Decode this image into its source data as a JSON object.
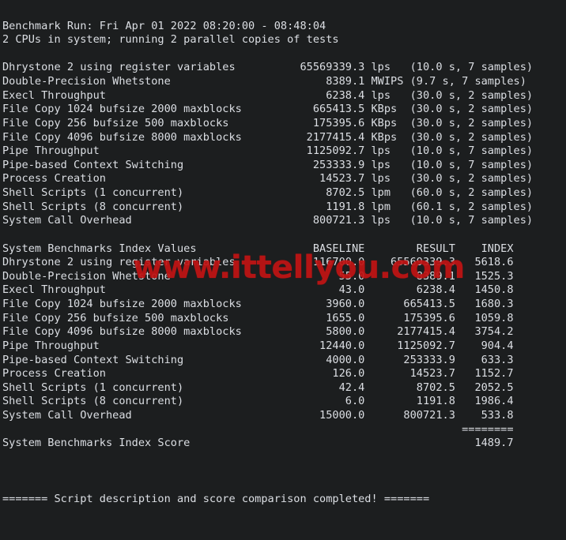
{
  "terminal": {
    "background_color": "#1c1e1f",
    "text_color": "#dcdfe4",
    "watermark": {
      "text": "www.ittellyou.com",
      "color": "#c01414"
    }
  },
  "header": {
    "benchmark_run_line": "Benchmark Run: Fri Apr 01 2022 08:20:00 - 08:48:04",
    "cpu_line": "2 CPUs in system; running 2 parallel copies of tests"
  },
  "raw_results": {
    "rows": [
      {
        "name": "Dhrystone 2 using register variables",
        "value": "65569339.3",
        "unit": "lps",
        "timing": "(10.0 s, 7 samples)"
      },
      {
        "name": "Double-Precision Whetstone",
        "value": "8389.1",
        "unit": "MWIPS",
        "timing": "(9.7 s, 7 samples)"
      },
      {
        "name": "Execl Throughput",
        "value": "6238.4",
        "unit": "lps",
        "timing": "(30.0 s, 2 samples)"
      },
      {
        "name": "File Copy 1024 bufsize 2000 maxblocks",
        "value": "665413.5",
        "unit": "KBps",
        "timing": "(30.0 s, 2 samples)"
      },
      {
        "name": "File Copy 256 bufsize 500 maxblocks",
        "value": "175395.6",
        "unit": "KBps",
        "timing": "(30.0 s, 2 samples)"
      },
      {
        "name": "File Copy 4096 bufsize 8000 maxblocks",
        "value": "2177415.4",
        "unit": "KBps",
        "timing": "(30.0 s, 2 samples)"
      },
      {
        "name": "Pipe Throughput",
        "value": "1125092.7",
        "unit": "lps",
        "timing": "(10.0 s, 7 samples)"
      },
      {
        "name": "Pipe-based Context Switching",
        "value": "253333.9",
        "unit": "lps",
        "timing": "(10.0 s, 7 samples)"
      },
      {
        "name": "Process Creation",
        "value": "14523.7",
        "unit": "lps",
        "timing": "(30.0 s, 2 samples)"
      },
      {
        "name": "Shell Scripts (1 concurrent)",
        "value": "8702.5",
        "unit": "lpm",
        "timing": "(60.0 s, 2 samples)"
      },
      {
        "name": "Shell Scripts (8 concurrent)",
        "value": "1191.8",
        "unit": "lpm",
        "timing": "(60.1 s, 2 samples)"
      },
      {
        "name": "System Call Overhead",
        "value": "800721.3",
        "unit": "lps",
        "timing": "(10.0 s, 7 samples)"
      }
    ]
  },
  "index_table": {
    "title": "System Benchmarks Index Values",
    "columns": [
      "BASELINE",
      "RESULT",
      "INDEX"
    ],
    "rows": [
      {
        "name": "Dhrystone 2 using register variables",
        "baseline": "116700.0",
        "result": "65569339.3",
        "index": "5618.6"
      },
      {
        "name": "Double-Precision Whetstone",
        "baseline": "55.0",
        "result": "8389.1",
        "index": "1525.3"
      },
      {
        "name": "Execl Throughput",
        "baseline": "43.0",
        "result": "6238.4",
        "index": "1450.8"
      },
      {
        "name": "File Copy 1024 bufsize 2000 maxblocks",
        "baseline": "3960.0",
        "result": "665413.5",
        "index": "1680.3"
      },
      {
        "name": "File Copy 256 bufsize 500 maxblocks",
        "baseline": "1655.0",
        "result": "175395.6",
        "index": "1059.8"
      },
      {
        "name": "File Copy 4096 bufsize 8000 maxblocks",
        "baseline": "5800.0",
        "result": "2177415.4",
        "index": "3754.2"
      },
      {
        "name": "Pipe Throughput",
        "baseline": "12440.0",
        "result": "1125092.7",
        "index": "904.4"
      },
      {
        "name": "Pipe-based Context Switching",
        "baseline": "4000.0",
        "result": "253333.9",
        "index": "633.3"
      },
      {
        "name": "Process Creation",
        "baseline": "126.0",
        "result": "14523.7",
        "index": "1152.7"
      },
      {
        "name": "Shell Scripts (1 concurrent)",
        "baseline": "42.4",
        "result": "8702.5",
        "index": "2052.5"
      },
      {
        "name": "Shell Scripts (8 concurrent)",
        "baseline": "6.0",
        "result": "1191.8",
        "index": "1986.4"
      },
      {
        "name": "System Call Overhead",
        "baseline": "15000.0",
        "result": "800721.3",
        "index": "533.8"
      }
    ],
    "separator": "========",
    "score_label": "System Benchmarks Index Score",
    "score_value": "1489.7"
  },
  "footer": {
    "completed_line": "======= Script description and score comparison completed! ======="
  }
}
